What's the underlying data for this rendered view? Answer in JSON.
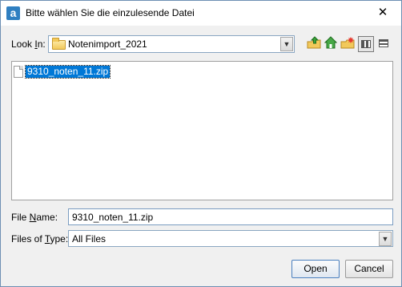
{
  "window": {
    "title": "Bitte wählen Sie die einzulesende Datei",
    "app_icon_glyph": "a",
    "close_glyph": "✕"
  },
  "lookin": {
    "label_pre": "Look ",
    "label_mn": "I",
    "label_post": "n:",
    "folder": "Notenimport_2021"
  },
  "toolbar": {
    "icons": [
      "up-one-level-icon",
      "home-icon",
      "new-folder-icon",
      "list-view-icon",
      "details-view-icon"
    ]
  },
  "files": [
    {
      "name": "9310_noten_11.zip",
      "selected": true
    }
  ],
  "filename": {
    "label_pre": "File ",
    "label_mn": "N",
    "label_post": "ame:",
    "value": "9310_noten_11.zip"
  },
  "filetype": {
    "label_pre": "Files of ",
    "label_mn": "T",
    "label_post": "ype:",
    "value": "All Files"
  },
  "buttons": {
    "open": "Open",
    "cancel": "Cancel"
  }
}
